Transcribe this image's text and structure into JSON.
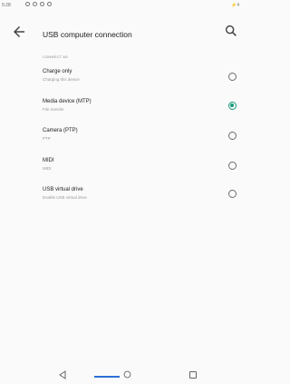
{
  "status_bar": {
    "time": "5:28",
    "right": "⚡4"
  },
  "toolbar": {
    "title": "USB computer connection"
  },
  "section": {
    "header": "CONNECT AS"
  },
  "options": [
    {
      "title": "Charge only",
      "subtitle": "Charging this device",
      "selected": false
    },
    {
      "title": "Media device (MTP)",
      "subtitle": "File transfer",
      "selected": true
    },
    {
      "title": "Camera (PTP)",
      "subtitle": "PTP",
      "selected": false
    },
    {
      "title": "MIDI",
      "subtitle": "MIDI",
      "selected": false
    },
    {
      "title": "USB virtual drive",
      "subtitle": "Enable USB virtual drive",
      "selected": false
    }
  ],
  "colors": {
    "accent": "#1a9b7c",
    "nav_accent": "#2d6fd6"
  },
  "icons": {
    "back": "arrow-left-icon",
    "search": "search-icon",
    "nav_back": "triangle-back-icon",
    "nav_home": "circle-home-icon",
    "nav_recent": "square-recents-icon"
  }
}
